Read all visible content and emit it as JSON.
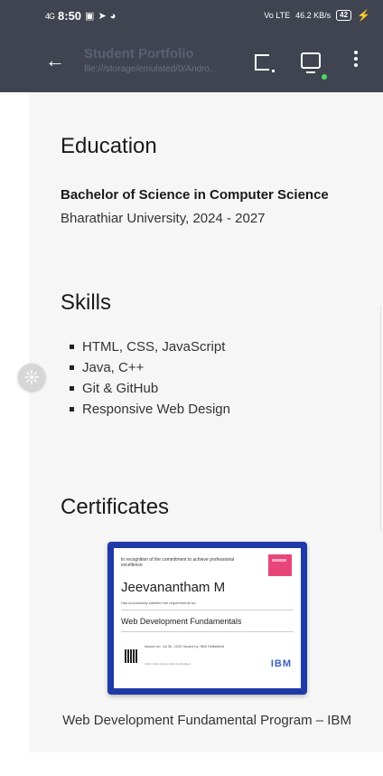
{
  "status_bar": {
    "signal": "4G",
    "time": "8:50",
    "battery": "42",
    "net_left": "Vo LTE",
    "net_speed": "46.2 KB/s"
  },
  "app_bar": {
    "title": "Student Portfolio",
    "subtitle": "file:///storage/emulated/0/Andro..."
  },
  "education": {
    "heading": "Education",
    "degree": "Bachelor of Science in Computer Science",
    "school": "Bharathiar University, 2024 - 2027"
  },
  "skills": {
    "heading": "Skills",
    "items": [
      "HTML, CSS, JavaScript",
      "Java, C++",
      "Git & GitHub",
      "Responsive Web Design"
    ]
  },
  "certificates": {
    "heading": "Certificates",
    "card": {
      "recognition": "In recognition of the commitment to achieve professional excellence",
      "name": "Jeevanantham M",
      "requirements": "Has successfully satisfied the requirements for:",
      "course": "Web Development Fundamentals",
      "issued": "Issued on: Jul 30, 2025 Issued by: IBM SkillsBuild",
      "verify": "Verify: https://www.credly.com/badges/...",
      "issuer_logo": "IBM"
    },
    "caption": "Web Development Fundamental Program – IBM"
  },
  "colors": {
    "app_bar_bg": "#3f4450",
    "page_bg": "#f6f6f6",
    "cert_border": "#1f3aa6",
    "ibm_blue": "#3b5fc4"
  }
}
